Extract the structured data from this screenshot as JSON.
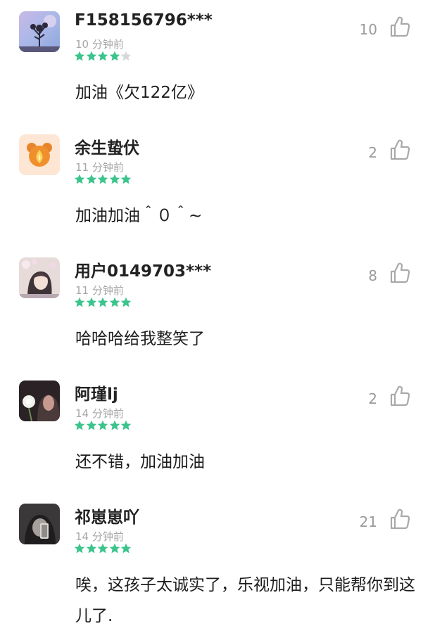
{
  "colors": {
    "star_filled": "#3cc48c",
    "star_empty": "#d8d8d8",
    "username": "#222222",
    "time": "#a7a7a7",
    "like_count": "#9a9a9a",
    "content": "#1d1d1d"
  },
  "icons": {
    "like": "thumbs-up-outline",
    "rating": "star"
  },
  "comments": [
    {
      "username": "F158156796***",
      "time": "10 分钟前",
      "rating": 4,
      "likes": "10",
      "content": "加油《欠122亿》",
      "avatar": "tree-sky-avatar"
    },
    {
      "username": "余生蛰伏",
      "time": "11 分钟前",
      "rating": 5,
      "likes": "2",
      "content": "加油加油＾０＾~",
      "avatar": "orange-bear-avatar"
    },
    {
      "username": "用户0149703***",
      "time": "11 分钟前",
      "rating": 5,
      "likes": "8",
      "content": "哈哈哈给我整笑了",
      "avatar": "anime-girl-blossom-avatar"
    },
    {
      "username": "阿瑾lj",
      "time": "14 分钟前",
      "rating": 5,
      "likes": "2",
      "content": "还不错，加油加油",
      "avatar": "girl-flower-dark-avatar"
    },
    {
      "username": "祁崽崽吖",
      "time": "14 分钟前",
      "rating": 5,
      "likes": "21",
      "content": "唉，这孩子太诚实了，乐视加油，只能帮你到这儿了.",
      "avatar": "girl-phone-dark-avatar"
    }
  ]
}
